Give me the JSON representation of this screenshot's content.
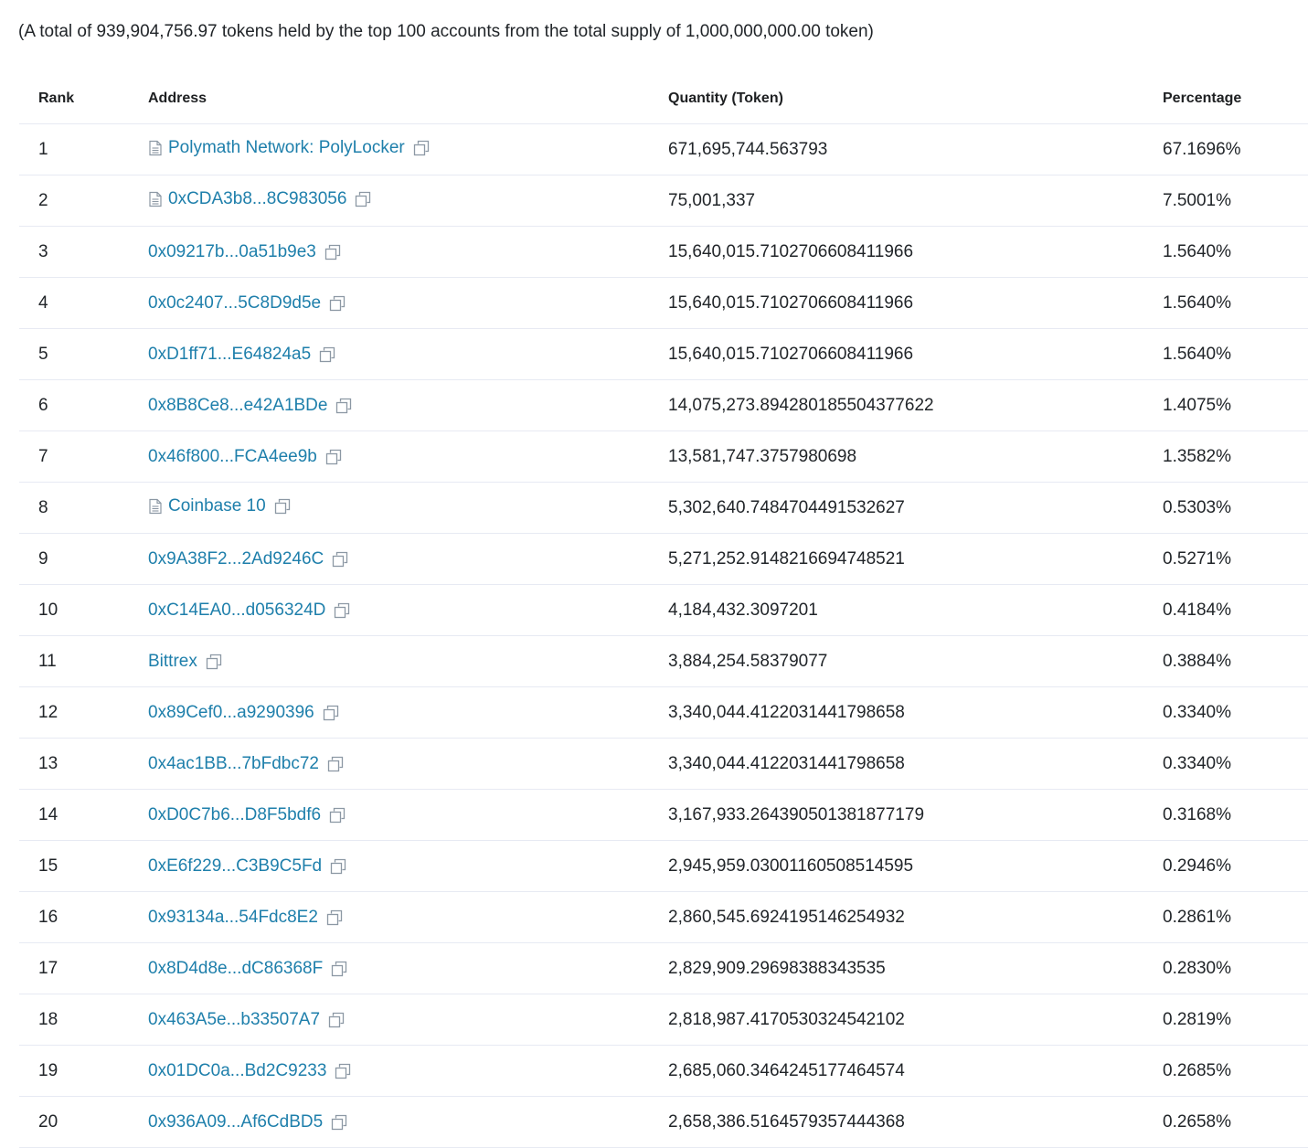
{
  "summary": "(A total of 939,904,756.97 tokens held by the top 100 accounts from the total supply of 1,000,000,000.00 token)",
  "headers": {
    "rank": "Rank",
    "address": "Address",
    "quantity": "Quantity (Token)",
    "percentage": "Percentage"
  },
  "colors": {
    "link": "#1e7fab",
    "text": "#212529",
    "border": "#e7eaf3",
    "icon": "#8c98a4"
  },
  "rows": [
    {
      "rank": "1",
      "address": "Polymath Network: PolyLocker",
      "contract": true,
      "quantity": "671,695,744.563793",
      "percentage": "67.1696%"
    },
    {
      "rank": "2",
      "address": "0xCDA3b8...8C983056",
      "contract": true,
      "quantity": "75,001,337",
      "percentage": "7.5001%"
    },
    {
      "rank": "3",
      "address": "0x09217b...0a51b9e3",
      "contract": false,
      "quantity": "15,640,015.7102706608411966",
      "percentage": "1.5640%"
    },
    {
      "rank": "4",
      "address": "0x0c2407...5C8D9d5e",
      "contract": false,
      "quantity": "15,640,015.7102706608411966",
      "percentage": "1.5640%"
    },
    {
      "rank": "5",
      "address": "0xD1ff71...E64824a5",
      "contract": false,
      "quantity": "15,640,015.7102706608411966",
      "percentage": "1.5640%"
    },
    {
      "rank": "6",
      "address": "0x8B8Ce8...e42A1BDe",
      "contract": false,
      "quantity": "14,075,273.894280185504377622",
      "percentage": "1.4075%"
    },
    {
      "rank": "7",
      "address": "0x46f800...FCA4ee9b",
      "contract": false,
      "quantity": "13,581,747.3757980698",
      "percentage": "1.3582%"
    },
    {
      "rank": "8",
      "address": "Coinbase 10",
      "contract": true,
      "quantity": "5,302,640.7484704491532627",
      "percentage": "0.5303%"
    },
    {
      "rank": "9",
      "address": "0x9A38F2...2Ad9246C",
      "contract": false,
      "quantity": "5,271,252.9148216694748521",
      "percentage": "0.5271%"
    },
    {
      "rank": "10",
      "address": "0xC14EA0...d056324D",
      "contract": false,
      "quantity": "4,184,432.3097201",
      "percentage": "0.4184%"
    },
    {
      "rank": "11",
      "address": "Bittrex",
      "contract": false,
      "quantity": "3,884,254.58379077",
      "percentage": "0.3884%"
    },
    {
      "rank": "12",
      "address": "0x89Cef0...a9290396",
      "contract": false,
      "quantity": "3,340,044.4122031441798658",
      "percentage": "0.3340%"
    },
    {
      "rank": "13",
      "address": "0x4ac1BB...7bFdbc72",
      "contract": false,
      "quantity": "3,340,044.4122031441798658",
      "percentage": "0.3340%"
    },
    {
      "rank": "14",
      "address": "0xD0C7b6...D8F5bdf6",
      "contract": false,
      "quantity": "3,167,933.264390501381877179",
      "percentage": "0.3168%"
    },
    {
      "rank": "15",
      "address": "0xE6f229...C3B9C5Fd",
      "contract": false,
      "quantity": "2,945,959.03001160508514595",
      "percentage": "0.2946%"
    },
    {
      "rank": "16",
      "address": "0x93134a...54Fdc8E2",
      "contract": false,
      "quantity": "2,860,545.6924195146254932",
      "percentage": "0.2861%"
    },
    {
      "rank": "17",
      "address": "0x8D4d8e...dC86368F",
      "contract": false,
      "quantity": "2,829,909.29698388343535",
      "percentage": "0.2830%"
    },
    {
      "rank": "18",
      "address": "0x463A5e...b33507A7",
      "contract": false,
      "quantity": "2,818,987.4170530324542102",
      "percentage": "0.2819%"
    },
    {
      "rank": "19",
      "address": "0x01DC0a...Bd2C9233",
      "contract": false,
      "quantity": "2,685,060.3464245177464574",
      "percentage": "0.2685%"
    },
    {
      "rank": "20",
      "address": "0x936A09...Af6CdBD5",
      "contract": false,
      "quantity": "2,658,386.5164579357444368",
      "percentage": "0.2658%"
    }
  ]
}
